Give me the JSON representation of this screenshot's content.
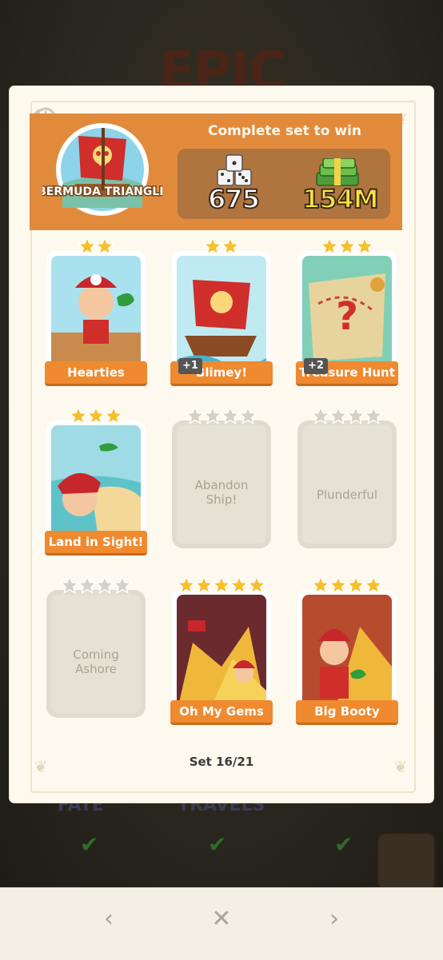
{
  "background": {
    "title": "EPIC",
    "labels": [
      "FATE",
      "TRAVELS"
    ]
  },
  "header": {
    "set_badge": "BERMUDA TRIANGLE",
    "prize_caption": "Complete set to win",
    "prize_dice": "675",
    "prize_cash": "154M"
  },
  "stickers": [
    {
      "name": "Hearties",
      "stars": 2,
      "collected": true,
      "extra": ""
    },
    {
      "name": "Blimey!",
      "stars": 2,
      "collected": true,
      "extra": "+1"
    },
    {
      "name": "Treasure Hunt",
      "stars": 3,
      "collected": true,
      "extra": "+2"
    },
    {
      "name": "Land in Sight!",
      "stars": 3,
      "collected": true,
      "extra": ""
    },
    {
      "name": "Abandon Ship!",
      "stars": 4,
      "collected": false,
      "extra": ""
    },
    {
      "name": "Plunderful",
      "stars": 4,
      "collected": false,
      "extra": ""
    },
    {
      "name": "Coming Ashore",
      "stars": 4,
      "collected": false,
      "extra": ""
    },
    {
      "name": "Oh My Gems",
      "stars": 5,
      "collected": true,
      "extra": ""
    },
    {
      "name": "Big Booty",
      "stars": 4,
      "collected": true,
      "extra": ""
    }
  ],
  "set_counter": "Set 16/21",
  "colors": {
    "header": "#e28a3c",
    "ribbon": "#ef8a30",
    "star_gold": "#f6c02c",
    "star_grey": "#d6d1c4"
  },
  "nav": {
    "prev_icon": "chevron-left-icon",
    "close_icon": "close-icon",
    "next_icon": "chevron-right-icon"
  }
}
